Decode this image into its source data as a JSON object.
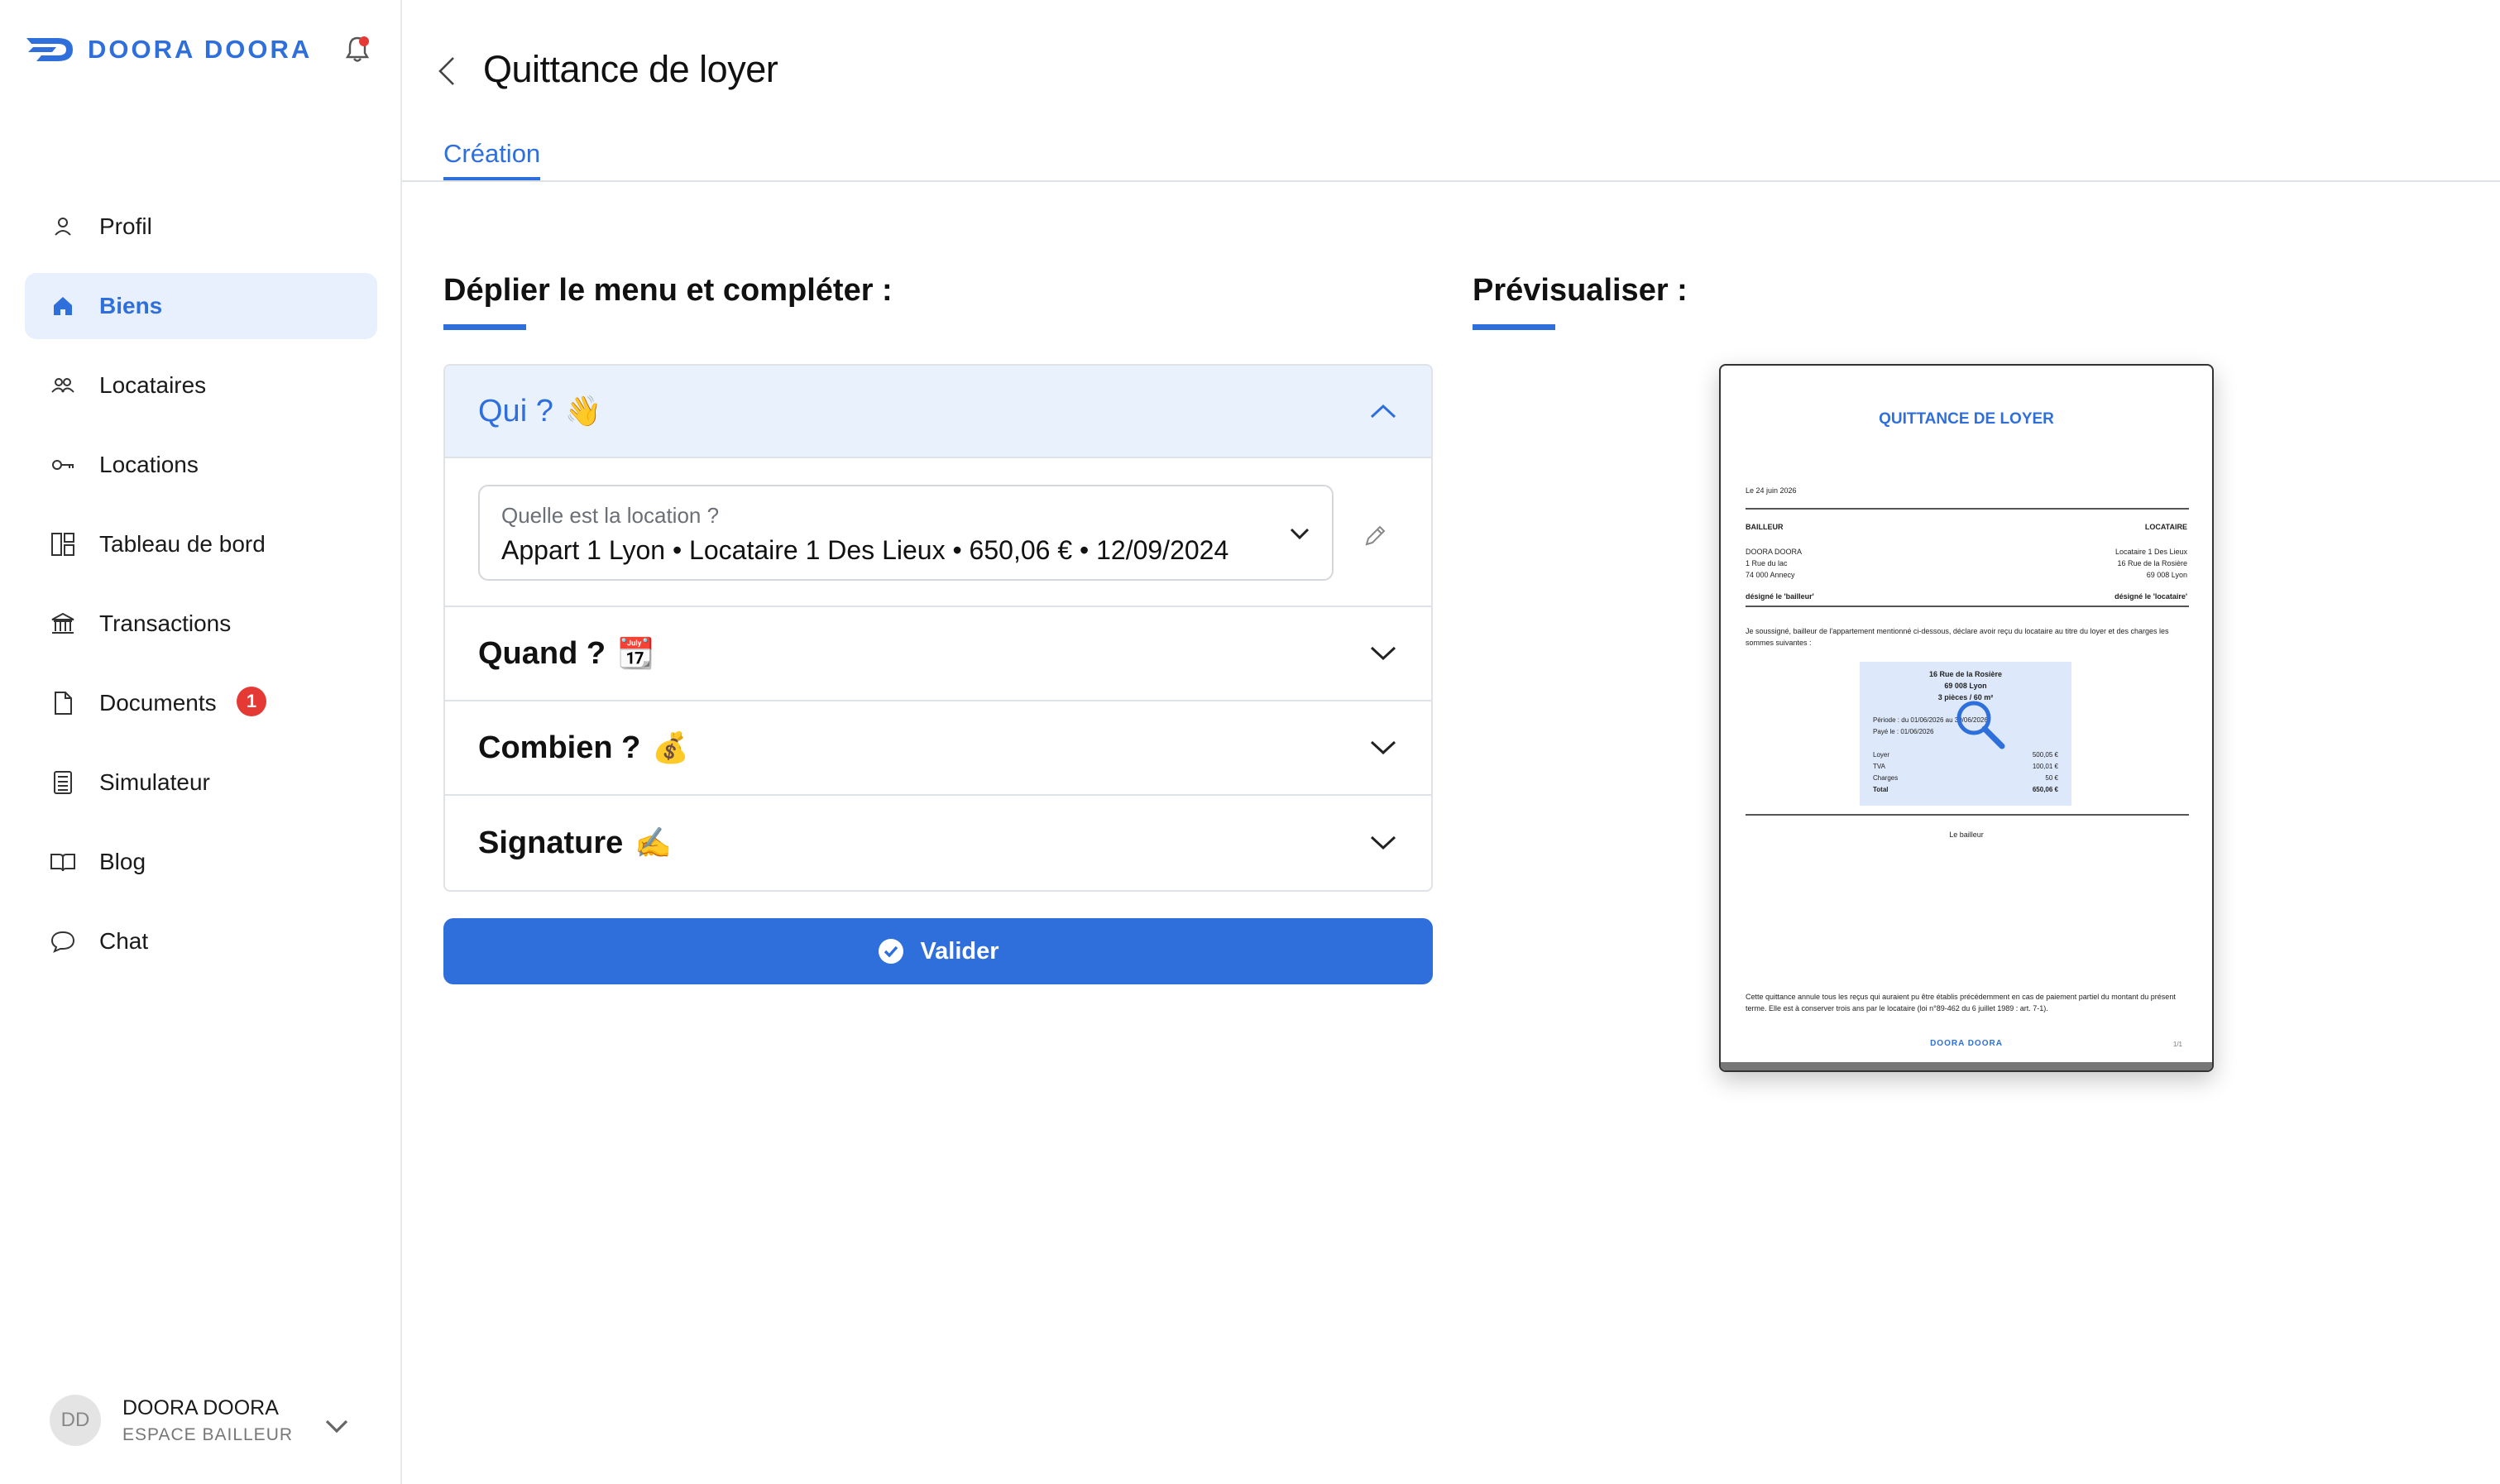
{
  "brand": {
    "name": "DOORA DOORA",
    "accent": "#2f6fdb"
  },
  "sidebar": {
    "items": [
      {
        "label": "Profil",
        "icon": "user-icon"
      },
      {
        "label": "Biens",
        "icon": "home-icon",
        "active": true
      },
      {
        "label": "Locataires",
        "icon": "people-icon"
      },
      {
        "label": "Locations",
        "icon": "key-icon"
      },
      {
        "label": "Tableau de bord",
        "icon": "dashboard-icon"
      },
      {
        "label": "Transactions",
        "icon": "bank-icon"
      },
      {
        "label": "Documents",
        "icon": "document-icon",
        "badge": "1"
      },
      {
        "label": "Simulateur",
        "icon": "calculator-icon"
      },
      {
        "label": "Blog",
        "icon": "book-icon"
      },
      {
        "label": "Chat",
        "icon": "chat-icon"
      }
    ]
  },
  "user": {
    "initials": "DD",
    "name": "DOORA DOORA",
    "role": "ESPACE BAILLEUR"
  },
  "header": {
    "title": "Quittance de loyer",
    "tab": "Création"
  },
  "form": {
    "section_title": "Déplier le menu et compléter :",
    "accordion": [
      {
        "label": "Qui ?",
        "emoji": "👋",
        "open": true
      },
      {
        "label": "Quand ?",
        "emoji": "📆"
      },
      {
        "label": "Combien ?",
        "emoji": "💰"
      },
      {
        "label": "Signature",
        "emoji": "✍️"
      }
    ],
    "location_select": {
      "label": "Quelle est la location ?",
      "value": "Appart 1 Lyon • Locataire 1 Des Lieux • 650,06 € • 12/09/2024"
    },
    "submit_label": "Valider"
  },
  "preview": {
    "section_title": "Prévisualiser :",
    "doc": {
      "title": "QUITTANCE DE LOYER",
      "date": "Le 24 juin 2026",
      "bailleur_heading": "BAILLEUR",
      "locataire_heading": "LOCATAIRE",
      "bailleur_lines": [
        "DOORA DOORA",
        "1 Rue du lac",
        "74 000 Annecy"
      ],
      "locataire_lines": [
        "Locataire 1 Des Lieux",
        "16 Rue de la Rosière",
        "69 008 Lyon"
      ],
      "bailleur_designation": "désigné le 'bailleur'",
      "locataire_designation": "désigné le 'locataire'",
      "body_text": "Je soussigné, bailleur de l'appartement mentionné ci-dessous, déclare avoir reçu du locataire au titre du loyer et des charges les sommes suivantes :",
      "property_lines": [
        "16 Rue de la Rosière",
        "69 008 Lyon",
        "3 pièces / 60 m²"
      ],
      "period": "Période : du 01/06/2026 au 30/06/2026",
      "paid": "Payé le : 01/06/2026",
      "amounts": [
        {
          "label": "Loyer",
          "value": "500,05 €"
        },
        {
          "label": "TVA",
          "value": "100,01 €"
        },
        {
          "label": "Charges",
          "value": "50 €"
        },
        {
          "label": "Total",
          "value": "650,06 €"
        }
      ],
      "signature_label": "Le bailleur",
      "footer_text": "Cette quittance annule tous les reçus qui auraient pu être établis précédemment en cas de paiement partiel du montant du présent terme. Elle est à conserver trois ans par le locataire (loi n°89-462 du 6 juillet 1989 : art. 7-1).",
      "logo": "DOORA DOORA",
      "page": "1/1"
    }
  }
}
